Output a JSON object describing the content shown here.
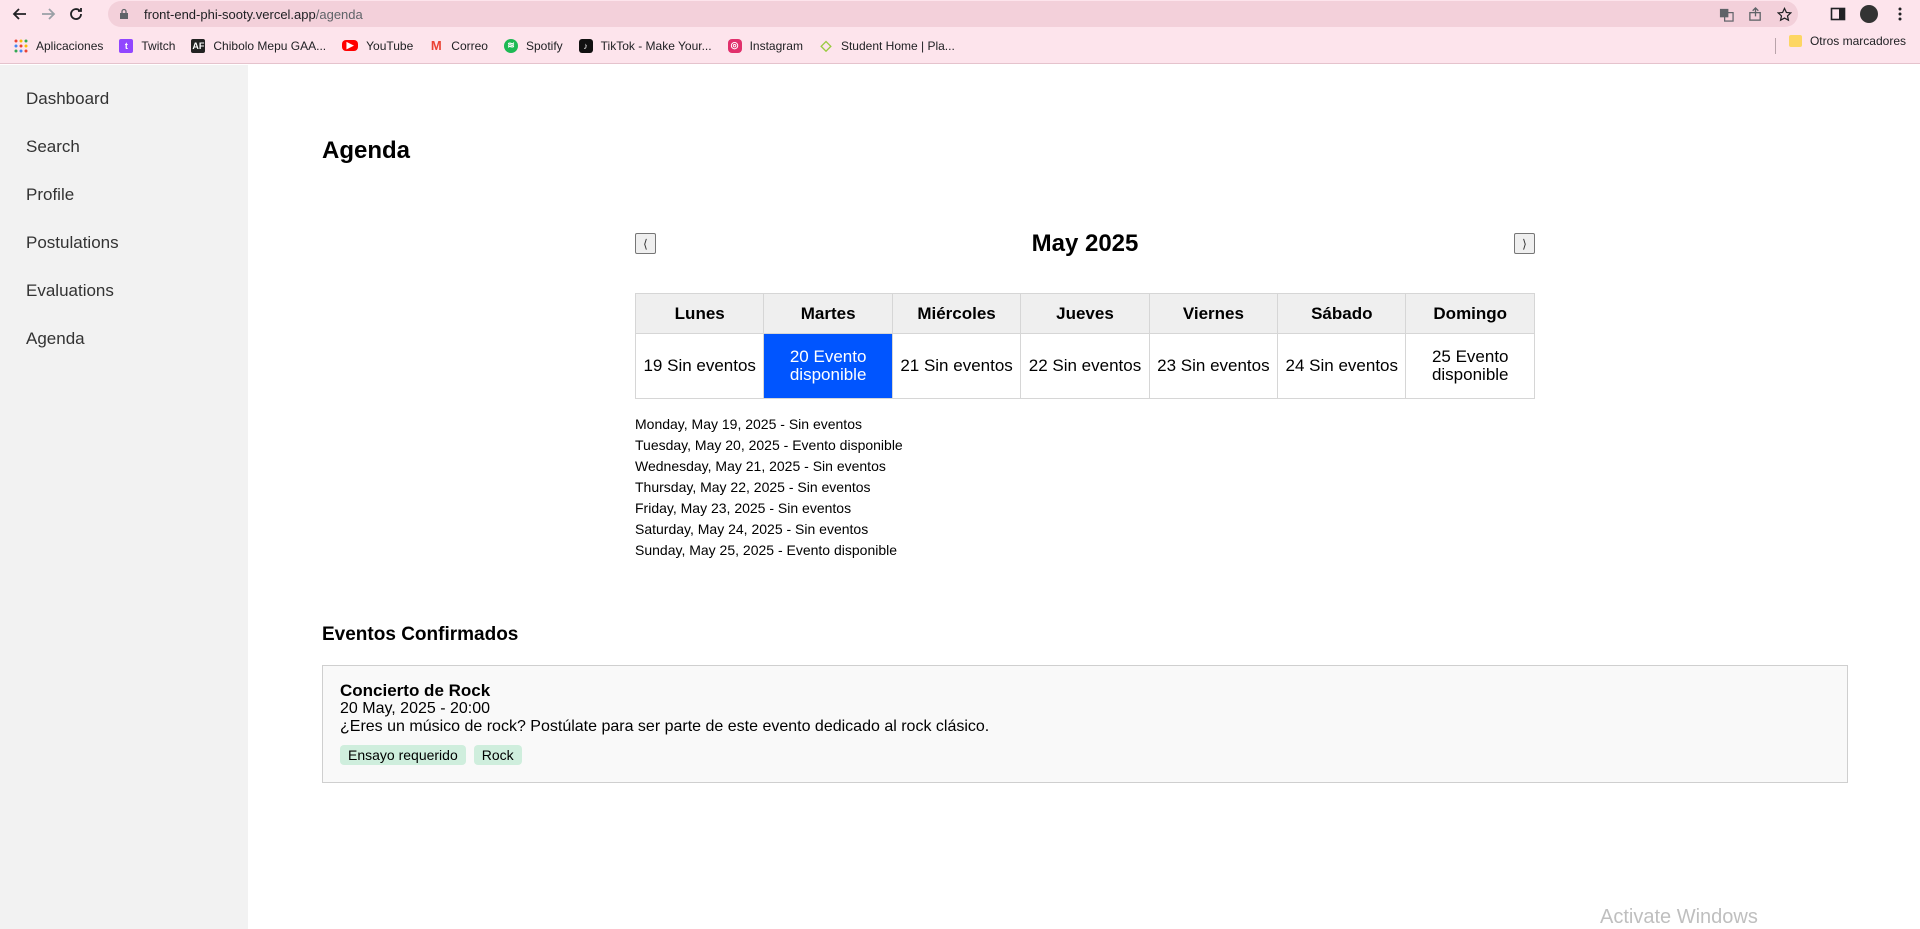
{
  "browser": {
    "url_host": "front-end-phi-sooty.vercel.app",
    "url_path": "/agenda",
    "bookmarks": [
      {
        "label": "Aplicaciones",
        "icon": "apps-grid-icon",
        "color": "#e8453c"
      },
      {
        "label": "Twitch",
        "icon": "twitch-icon",
        "color": "#9146ff"
      },
      {
        "label": "Chibolo Mepu GAA...",
        "icon": "af-icon",
        "color": "#222222"
      },
      {
        "label": "YouTube",
        "icon": "youtube-icon",
        "color": "#ff0000"
      },
      {
        "label": "Correo",
        "icon": "gmail-icon",
        "color": "#ea4335"
      },
      {
        "label": "Spotify",
        "icon": "spotify-icon",
        "color": "#1db954"
      },
      {
        "label": "TikTok - Make Your...",
        "icon": "tiktok-icon",
        "color": "#111111"
      },
      {
        "label": "Instagram",
        "icon": "instagram-icon",
        "color": "#e1306c"
      },
      {
        "label": "Student Home | Pla...",
        "icon": "platzi-icon",
        "color": "#98ca3f"
      }
    ],
    "other_bookmarks": "Otros marcadores"
  },
  "sidebar": {
    "items": [
      {
        "label": "Dashboard"
      },
      {
        "label": "Search"
      },
      {
        "label": "Profile"
      },
      {
        "label": "Postulations"
      },
      {
        "label": "Evaluations"
      },
      {
        "label": "Agenda"
      }
    ]
  },
  "page": {
    "title": "Agenda"
  },
  "calendar": {
    "month": "May 2025",
    "prev_label": "⟨",
    "next_label": "⟩",
    "weekdays": [
      "Lunes",
      "Martes",
      "Miércoles",
      "Jueves",
      "Viernes",
      "Sábado",
      "Domingo"
    ],
    "days": [
      {
        "text": "19 Sin eventos",
        "selected": false
      },
      {
        "text": "20 Evento disponible",
        "selected": true
      },
      {
        "text": "21 Sin eventos",
        "selected": false
      },
      {
        "text": "22 Sin eventos",
        "selected": false
      },
      {
        "text": "23 Sin eventos",
        "selected": false
      },
      {
        "text": "24 Sin eventos",
        "selected": false
      },
      {
        "text": "25 Evento disponible",
        "selected": false
      }
    ],
    "selected_color": "#0055ff",
    "day_list": [
      "Monday, May 19, 2025 - Sin eventos",
      "Tuesday, May 20, 2025 - Evento disponible",
      "Wednesday, May 21, 2025 - Sin eventos",
      "Thursday, May 22, 2025 - Sin eventos",
      "Friday, May 23, 2025 - Sin eventos",
      "Saturday, May 24, 2025 - Sin eventos",
      "Sunday, May 25, 2025 - Evento disponible"
    ]
  },
  "confirmed": {
    "title": "Eventos Confirmados",
    "events": [
      {
        "name": "Concierto de Rock",
        "date": "20 May, 2025 - 20:00",
        "description": "¿Eres un músico de rock? Postúlate para ser parte de este evento dedicado al rock clásico.",
        "tags": [
          "Ensayo requerido",
          "Rock"
        ]
      }
    ]
  },
  "watermark": "Activate Windows"
}
